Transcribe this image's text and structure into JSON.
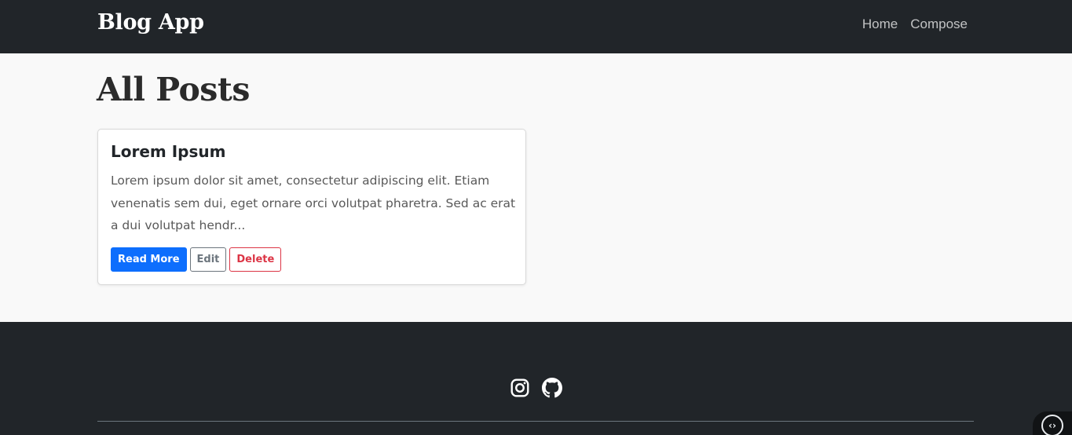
{
  "navbar": {
    "brand": "Blog App",
    "links": [
      {
        "label": "Home"
      },
      {
        "label": "Compose"
      }
    ]
  },
  "main": {
    "title": "All Posts",
    "posts": [
      {
        "title": "Lorem Ipsum",
        "excerpt": "Lorem ipsum dolor sit amet, consectetur adipiscing elit. Etiam venenatis sem dui, eget ornare orci volutpat pharetra. Sed ac erat a dui volutpat hendr...",
        "read_more_label": "Read More",
        "edit_label": "Edit",
        "delete_label": "Delete"
      }
    ]
  },
  "footer": {
    "icons": [
      "instagram-icon",
      "github-icon"
    ]
  },
  "widget": {
    "icon": "code-icon",
    "glyph": "‹›"
  },
  "colors": {
    "dark": "#212529",
    "primary": "#0d6efd",
    "secondary": "#6c757d",
    "danger": "#dc3545",
    "background": "#f9f9f9"
  }
}
